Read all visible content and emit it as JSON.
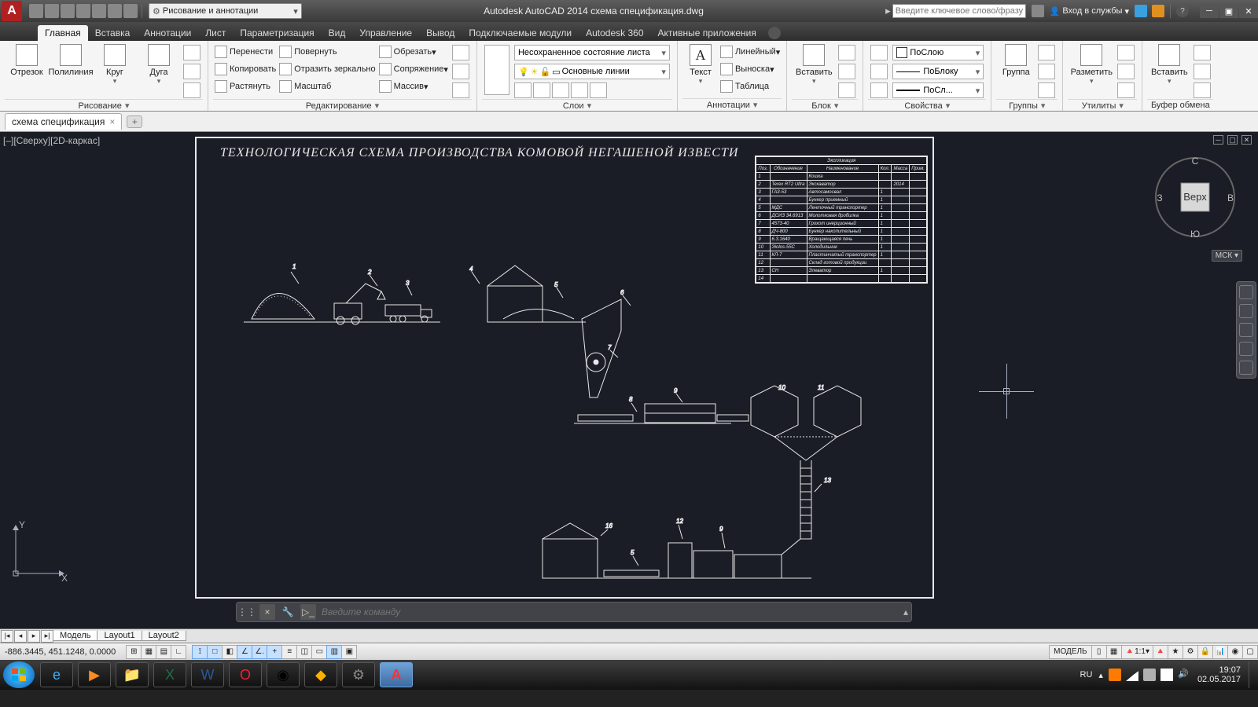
{
  "qat": {
    "workspace": "Рисование и аннотации",
    "title": "Autodesk AutoCAD 2014    схема  спецификация.dwg",
    "search_ph": "Введите ключевое слово/фразу",
    "signin": "Вход в службы"
  },
  "tabs": [
    "Главная",
    "Вставка",
    "Аннотации",
    "Лист",
    "Параметризация",
    "Вид",
    "Управление",
    "Вывод",
    "Подключаемые модули",
    "Autodesk 360",
    "Активные приложения"
  ],
  "ribbon": {
    "draw": {
      "items": [
        "Отрезок",
        "Полилиния",
        "Круг",
        "Дуга"
      ],
      "title": "Рисование"
    },
    "modify": {
      "items": [
        "Перенести",
        "Повернуть",
        "Обрезать",
        "Копировать",
        "Отразить зеркально",
        "Сопряжение",
        "Растянуть",
        "Масштаб",
        "Массив"
      ],
      "title": "Редактирование"
    },
    "layers": {
      "combo1": "Несохраненное состояние листа",
      "combo2": "Основные линии",
      "title": "Слои"
    },
    "annot": {
      "text": "Текст",
      "items": [
        "Линейный",
        "Выноска",
        "Таблица"
      ],
      "title": "Аннотации"
    },
    "block": {
      "insert": "Вставить",
      "title": "Блок"
    },
    "props": {
      "bylayer": "ПоСлою",
      "byblock": "ПоБлоку",
      "bylayerLW": "ПоСл...",
      "title": "Свойства"
    },
    "groups": {
      "btn": "Группа",
      "title": "Группы"
    },
    "utils": {
      "btn": "Разметить",
      "title": "Утилиты"
    },
    "paste": {
      "btn": "Вставить",
      "title": "Буфер обмена"
    }
  },
  "filetab": "схема  спецификация",
  "viewport": "[–][Сверху][2D-каркас]",
  "viewcube": {
    "center": "Верх",
    "n": "С",
    "s": "Ю",
    "e": "В",
    "w": "З"
  },
  "wcs": "МСК",
  "ucs": {
    "x": "X",
    "y": "Y"
  },
  "drawing_title": "ТЕХНОЛОГИЧЕСКАЯ  СХЕМА  ПРОИЗВОДСТВА  КОМОВОЙ  НЕГАШЕНОЙ  ИЗВЕСТИ",
  "spec_header": "Экспликация",
  "spec_cols": [
    "Поз.",
    "Обозначение",
    "Наименование",
    "Кол.",
    "Масса",
    "Прим."
  ],
  "spec_rows": [
    [
      "1",
      "",
      "Кошка",
      "",
      "",
      ""
    ],
    [
      "2",
      "Terex RT2 Ultrа",
      "Экскаватор",
      "",
      "2014",
      ""
    ],
    [
      "3",
      "ГАЗ-53",
      "Автосамосвал",
      "1",
      "",
      ""
    ],
    [
      "4",
      "",
      "Бункер приемный",
      "1",
      "",
      ""
    ],
    [
      "5",
      "МДС",
      "Ленточный транспортер",
      "1",
      "",
      ""
    ],
    [
      "6",
      "ДСИЗ 34.6913",
      "Молотковая дробилка",
      "1",
      "",
      ""
    ],
    [
      "7",
      "4573-40",
      "Грохот инерционный",
      "1",
      "",
      ""
    ],
    [
      "8",
      "ДЧ-800",
      "Бункер накопительный",
      "1",
      "",
      ""
    ],
    [
      "9",
      "6.3.1640",
      "Вращающаяся печь",
      "1",
      "",
      ""
    ],
    [
      "10",
      "Эiolоs-55С",
      "Холодильник",
      "1",
      "",
      ""
    ],
    [
      "11",
      "КЛ-7",
      "Пластинчатый транспортер",
      "1",
      "",
      ""
    ],
    [
      "12",
      "",
      "Склад готовой продукции",
      "",
      "",
      ""
    ],
    [
      "13",
      "СH",
      "Элеватор",
      "1",
      "",
      ""
    ],
    [
      "14",
      "",
      "",
      "",
      "",
      ""
    ]
  ],
  "cmd": {
    "ph": "Введите команду"
  },
  "layouts": {
    "model": "Модель",
    "l1": "Layout1",
    "l2": "Layout2"
  },
  "status": {
    "coords": "-886.3445,  451.1248, 0.0000",
    "model_btn": "МОДЕЛЬ",
    "scale": "1:1",
    "lang": "RU"
  },
  "clock": {
    "time": "19:07",
    "date": "02.05.2017"
  }
}
